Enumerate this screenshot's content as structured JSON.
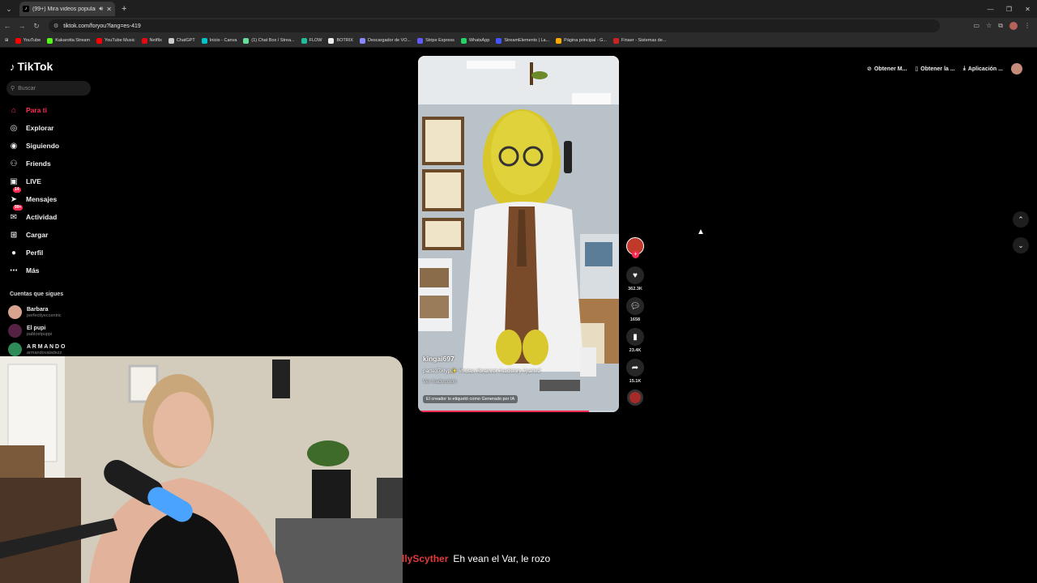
{
  "browser": {
    "tab_title": "(99+) Mira videos populares",
    "url": "tiktok.com/foryou?lang=es-419",
    "bookmarks": [
      {
        "label": "YouTube",
        "color": "#ff0000"
      },
      {
        "label": "Kakarotta Stream",
        "color": "#53fc18"
      },
      {
        "label": "YouTube Music",
        "color": "#ff0000"
      },
      {
        "label": "Netflix",
        "color": "#e50914"
      },
      {
        "label": "ChatGPT",
        "color": "#cccccc"
      },
      {
        "label": "Inicio - Canva",
        "color": "#00c4cc"
      },
      {
        "label": "(1) Chat Box / Strea...",
        "color": "#66dd99"
      },
      {
        "label": "FLOW",
        "color": "#22bb99"
      },
      {
        "label": "BOTRIX",
        "color": "#eeeeee"
      },
      {
        "label": "Descargador de VO...",
        "color": "#8888ff"
      },
      {
        "label": "Stripe Express",
        "color": "#635bff"
      },
      {
        "label": "WhatsApp",
        "color": "#25d366"
      },
      {
        "label": "StreamElements | La...",
        "color": "#4455ff"
      },
      {
        "label": "Página principal - G...",
        "color": "#ffaa00"
      },
      {
        "label": "Finaer - Sistemas de...",
        "color": "#cc2222"
      }
    ]
  },
  "tiktok": {
    "logo": "TikTok",
    "search_placeholder": "Buscar",
    "nav": [
      {
        "label": "Para ti",
        "icon": "home-icon",
        "glyph": "⌂",
        "active": true
      },
      {
        "label": "Explorar",
        "icon": "compass-icon",
        "glyph": "◎"
      },
      {
        "label": "Siguiendo",
        "icon": "following-icon",
        "glyph": "◉"
      },
      {
        "label": "Friends",
        "icon": "friends-icon",
        "glyph": "⚇"
      },
      {
        "label": "LIVE",
        "icon": "live-icon",
        "glyph": "▣"
      },
      {
        "label": "Mensajes",
        "icon": "messages-icon",
        "glyph": "➤",
        "badge": "14"
      },
      {
        "label": "Actividad",
        "icon": "activity-icon",
        "glyph": "✉",
        "badge": "99+"
      },
      {
        "label": "Cargar",
        "icon": "upload-icon",
        "glyph": "⊞"
      },
      {
        "label": "Perfil",
        "icon": "profile-icon",
        "glyph": "●"
      },
      {
        "label": "Más",
        "icon": "more-icon",
        "glyph": "⋯"
      }
    ],
    "following_title": "Cuentas que sigues",
    "following": [
      {
        "name": "Barbara",
        "handle": "perfectlyeccentric",
        "color": "#d8a48f"
      },
      {
        "name": "El pupi",
        "handle": "pabloelpuppi",
        "color": "#552244"
      },
      {
        "name": "A R M A N D O",
        "handle": "armandovaladezz",
        "color": "#2e8b57"
      }
    ],
    "top_actions": [
      "Obtener M...",
      "Obtener la ...",
      "Aplicación ..."
    ],
    "video": {
      "username": "kingai697",
      "description": "parte37#fyp✨ #frutas #brainrot #sadstory #parte2",
      "translation": "Ver traducción",
      "ai_label": "El creador lo etiquetó como Generado por IA",
      "progress": 0.85
    },
    "actions": {
      "likes": "362.3K",
      "comments": "1658",
      "saves": "23.4K",
      "shares": "15.1K"
    }
  },
  "chat": {
    "user": "llyScyther",
    "message": "Eh vean el Var, le rozo"
  }
}
